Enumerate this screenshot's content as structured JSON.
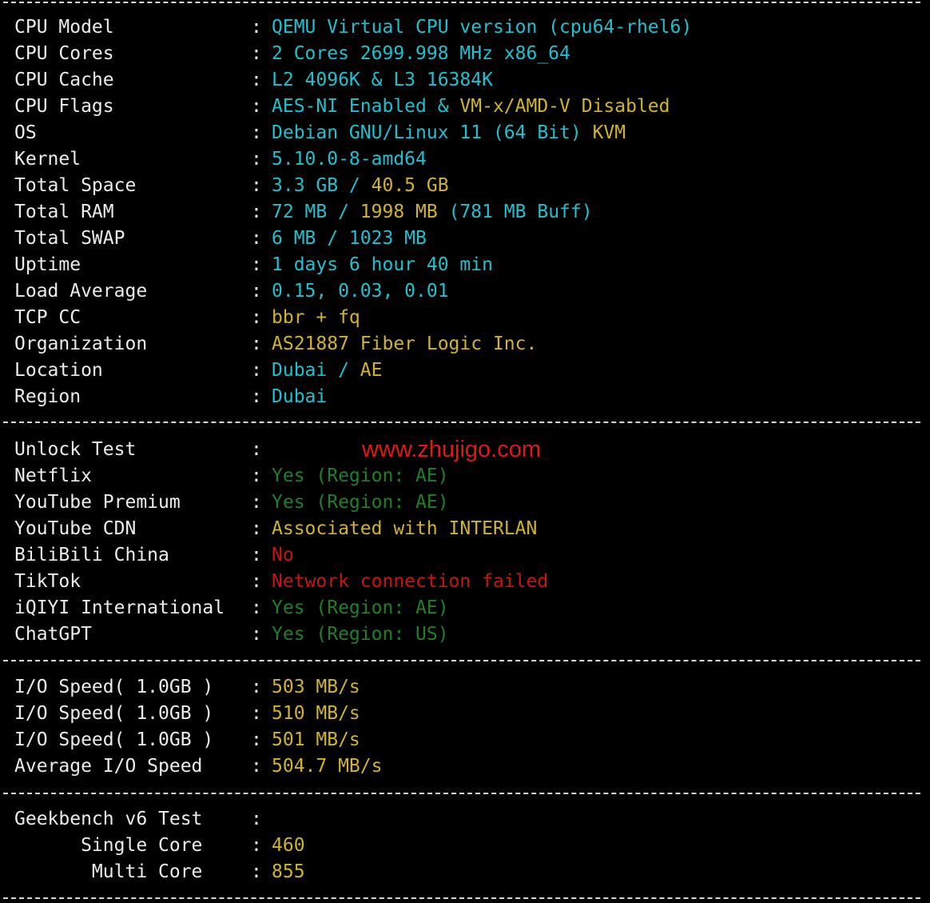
{
  "colors": {
    "background": "#000000",
    "label": "#ececec",
    "cyan": "#1fc1d0",
    "yellow": "#d1b32f",
    "green": "#1f7f2a",
    "red": "#c81414",
    "watermark": "#e01818"
  },
  "separator": ":",
  "system_info": [
    {
      "label": "CPU Model",
      "parts": [
        {
          "text": "QEMU Virtual CPU version (cpu64-rhel6)",
          "color": "cyan"
        }
      ]
    },
    {
      "label": "CPU Cores",
      "parts": [
        {
          "text": "2 Cores 2699.998 MHz x86_64",
          "color": "cyan"
        }
      ]
    },
    {
      "label": "CPU Cache",
      "parts": [
        {
          "text": "L2 4096K & L3 16384K",
          "color": "cyan"
        }
      ]
    },
    {
      "label": "CPU Flags",
      "parts": [
        {
          "text": "AES-NI Enabled & ",
          "color": "cyan"
        },
        {
          "text": "VM-x/AMD-V Disabled",
          "color": "yellow"
        }
      ]
    },
    {
      "label": "OS",
      "parts": [
        {
          "text": "Debian GNU/Linux 11 (64 Bit) ",
          "color": "cyan"
        },
        {
          "text": "KVM",
          "color": "yellow"
        }
      ]
    },
    {
      "label": "Kernel",
      "parts": [
        {
          "text": "5.10.0-8-amd64",
          "color": "cyan"
        }
      ]
    },
    {
      "label": "Total Space",
      "parts": [
        {
          "text": "3.3 GB / ",
          "color": "cyan"
        },
        {
          "text": "40.5 GB",
          "color": "yellow"
        }
      ]
    },
    {
      "label": "Total RAM",
      "parts": [
        {
          "text": "72 MB / ",
          "color": "cyan"
        },
        {
          "text": "1998 MB",
          "color": "yellow"
        },
        {
          "text": " (781 MB Buff)",
          "color": "cyan"
        }
      ]
    },
    {
      "label": "Total SWAP",
      "parts": [
        {
          "text": "6 MB / 1023 MB",
          "color": "cyan"
        }
      ]
    },
    {
      "label": "Uptime",
      "parts": [
        {
          "text": "1 days 6 hour 40 min",
          "color": "cyan"
        }
      ]
    },
    {
      "label": "Load Average",
      "parts": [
        {
          "text": "0.15, 0.03, 0.01",
          "color": "cyan"
        }
      ]
    },
    {
      "label": "TCP CC",
      "parts": [
        {
          "text": "bbr + fq",
          "color": "yellow"
        }
      ]
    },
    {
      "label": "Organization",
      "parts": [
        {
          "text": "AS21887 Fiber Logic Inc.",
          "color": "yellow"
        }
      ]
    },
    {
      "label": "Location",
      "parts": [
        {
          "text": "Dubai / ",
          "color": "cyan"
        },
        {
          "text": "AE",
          "color": "yellow"
        }
      ]
    },
    {
      "label": "Region",
      "parts": [
        {
          "text": "Dubai",
          "color": "cyan"
        }
      ]
    }
  ],
  "unlock_test": [
    {
      "label": "Unlock Test",
      "parts": []
    },
    {
      "label": "Netflix",
      "parts": [
        {
          "text": "Yes (Region: AE)",
          "color": "green"
        }
      ]
    },
    {
      "label": "YouTube Premium",
      "parts": [
        {
          "text": "Yes (Region: AE)",
          "color": "green"
        }
      ]
    },
    {
      "label": "YouTube CDN",
      "parts": [
        {
          "text": "Associated with INTERLAN",
          "color": "yellow"
        }
      ]
    },
    {
      "label": "BiliBili China",
      "parts": [
        {
          "text": "No",
          "color": "red"
        }
      ]
    },
    {
      "label": "TikTok",
      "parts": [
        {
          "text": "Network connection failed",
          "color": "red"
        }
      ]
    },
    {
      "label": "iQIYI International",
      "parts": [
        {
          "text": "Yes (Region: AE)",
          "color": "green"
        }
      ]
    },
    {
      "label": "ChatGPT",
      "parts": [
        {
          "text": "Yes (Region: US)",
          "color": "green"
        }
      ]
    }
  ],
  "io_test": [
    {
      "label": "I/O Speed( 1.0GB )",
      "parts": [
        {
          "text": "503 MB/s",
          "color": "yellow"
        }
      ]
    },
    {
      "label": "I/O Speed( 1.0GB )",
      "parts": [
        {
          "text": "510 MB/s",
          "color": "yellow"
        }
      ]
    },
    {
      "label": "I/O Speed( 1.0GB )",
      "parts": [
        {
          "text": "501 MB/s",
          "color": "yellow"
        }
      ]
    },
    {
      "label": "Average I/O Speed",
      "parts": [
        {
          "text": "504.7 MB/s",
          "color": "yellow"
        }
      ]
    }
  ],
  "geekbench": [
    {
      "label": "Geekbench v6 Test",
      "parts": []
    },
    {
      "label": "      Single Core",
      "parts": [
        {
          "text": "460",
          "color": "yellow"
        }
      ]
    },
    {
      "label": "       Multi Core",
      "parts": [
        {
          "text": "855",
          "color": "yellow"
        }
      ]
    }
  ],
  "watermark": "www.zhujigo.com"
}
